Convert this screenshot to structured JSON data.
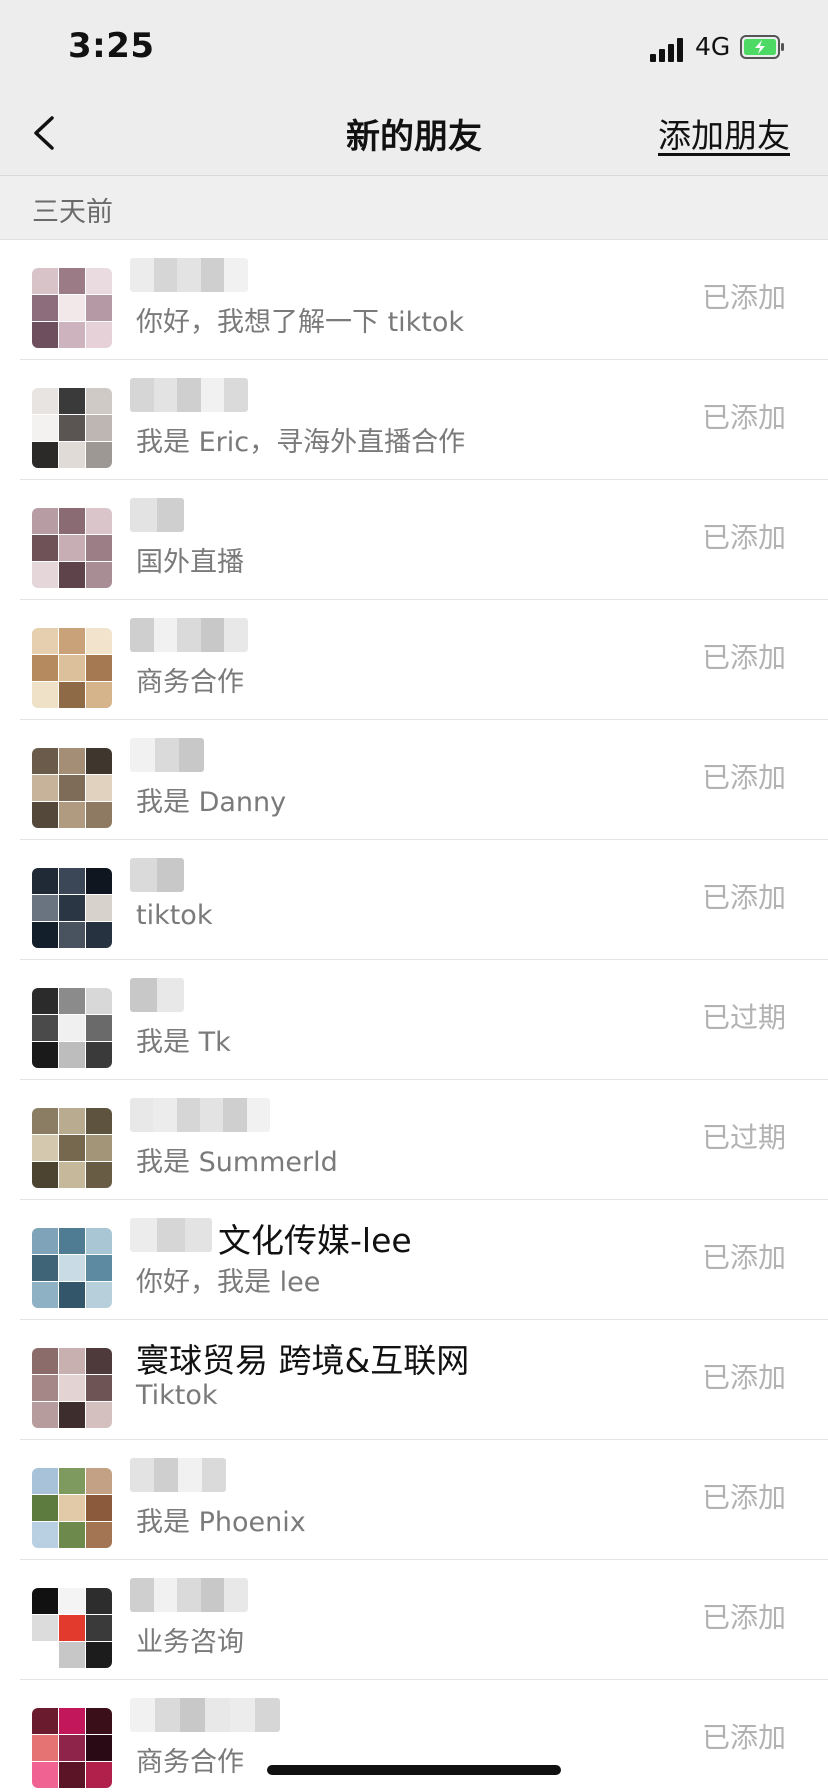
{
  "status_bar": {
    "time": "3:25",
    "network": "4G"
  },
  "nav": {
    "title": "新的朋友",
    "add_friend": "添加朋友"
  },
  "section": {
    "label": "三天前"
  },
  "colors": {
    "status_text": "#b2b2b2",
    "message_text": "#7a7a7a",
    "battery": "#4cd964"
  },
  "requests": [
    {
      "name": "",
      "message": "你好，我想了解一下 tiktok",
      "status": "已添加"
    },
    {
      "name": "",
      "message": "我是 Eric，寻海外直播合作",
      "status": "已添加"
    },
    {
      "name": "",
      "message": "国外直播",
      "status": "已添加"
    },
    {
      "name": "",
      "message": "商务合作",
      "status": "已添加"
    },
    {
      "name": "",
      "message": "我是 Danny",
      "status": "已添加"
    },
    {
      "name": "",
      "message": "tiktok",
      "status": "已添加"
    },
    {
      "name": "",
      "message": "我是 Tk",
      "status": "已过期"
    },
    {
      "name": "",
      "message": "我是 Summerld",
      "status": "已过期"
    },
    {
      "name": "文化传媒-lee",
      "message": "你好，我是 lee",
      "status": "已添加"
    },
    {
      "name": "寰球贸易  跨境&互联网",
      "message": "Tiktok",
      "status": "已添加"
    },
    {
      "name": "",
      "message": "我是 Phoenix",
      "status": "已添加"
    },
    {
      "name": "",
      "message": "业务咨询",
      "status": "已添加"
    },
    {
      "name": "",
      "message": "商务合作",
      "status": "已添加"
    }
  ]
}
